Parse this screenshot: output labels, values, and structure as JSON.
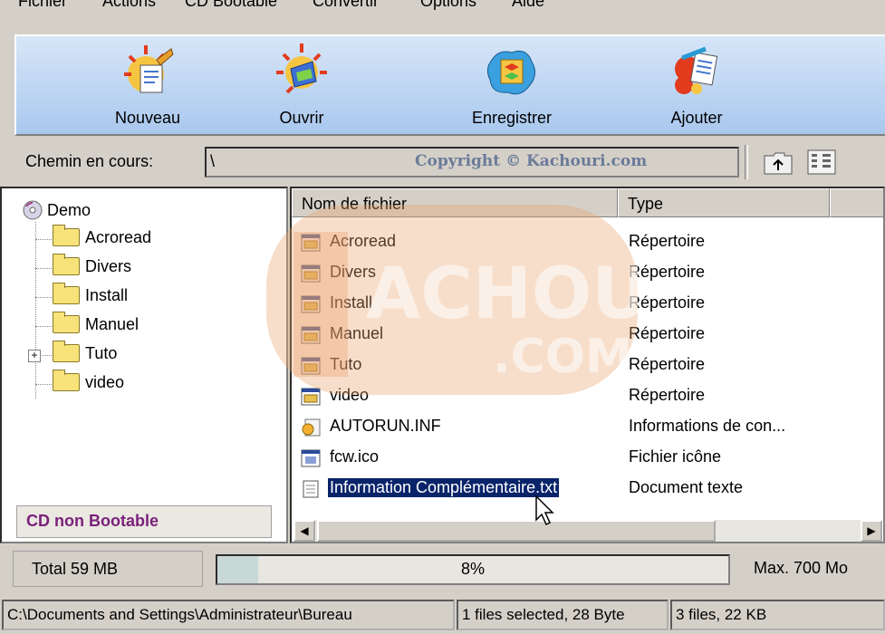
{
  "menu": [
    "Fichier",
    "Actions",
    "CD Bootable",
    "Convertir",
    "Options",
    "Aide"
  ],
  "toolbar": {
    "new_label": "Nouveau",
    "open_label": "Ouvrir",
    "save_label": "Enregistrer",
    "add_label": "Ajouter"
  },
  "pathbar": {
    "label": "Chemin en cours:",
    "value": "\\",
    "copyright": "Copyright © Kachouri.com"
  },
  "tree": {
    "root": "Demo",
    "items": [
      "Acroread",
      "Divers",
      "Install",
      "Manuel",
      "Tuto",
      "video"
    ],
    "boot_status": "CD non Bootable"
  },
  "filelist": {
    "col_name": "Nom de fichier",
    "col_type": "Type",
    "rows": [
      {
        "name": "Acroread",
        "type": "Répertoire"
      },
      {
        "name": "Divers",
        "type": "Répertoire"
      },
      {
        "name": "Install",
        "type": "Répertoire"
      },
      {
        "name": "Manuel",
        "type": "Répertoire"
      },
      {
        "name": "Tuto",
        "type": "Répertoire"
      },
      {
        "name": "video",
        "type": "Répertoire"
      },
      {
        "name": "AUTORUN.INF",
        "type": "Informations de con..."
      },
      {
        "name": "fcw.ico",
        "type": "Fichier icône"
      },
      {
        "name": "Information Complémentaire.txt",
        "type": "Document texte"
      }
    ]
  },
  "watermark": {
    "line1": "ACHOURI",
    "line2": ".COM"
  },
  "progress": {
    "total": "Total 59 MB",
    "percent_text": "8%",
    "fraction": 0.08,
    "max": "Max. 700 Mo"
  },
  "statusbar": {
    "path": "C:\\Documents and Settings\\Administrateur\\Bureau",
    "selection": "1 files selected, 28 Byte",
    "count": "3 files, 22 KB"
  },
  "colors": {
    "selection": "#0a246a",
    "boot_status_text": "#7a1f7a",
    "toolbar_top": "#d7e6f8",
    "toolbar_bottom": "#a9c8ee",
    "watermark": "#e8a06a"
  }
}
